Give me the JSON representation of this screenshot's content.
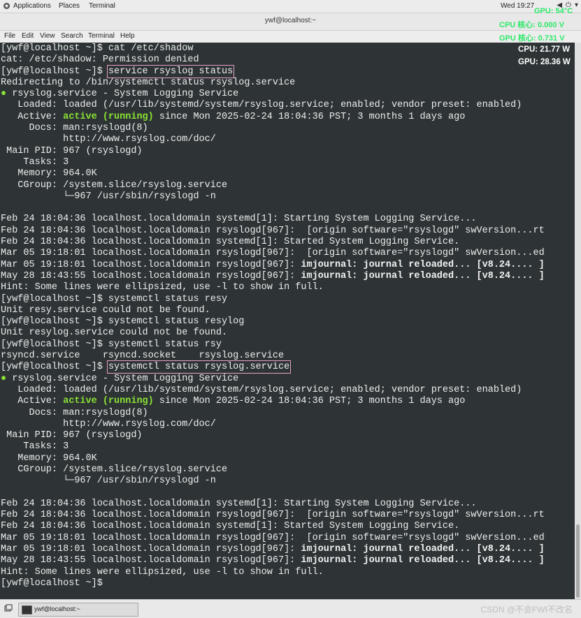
{
  "top_panel": {
    "applications": "Applications",
    "places": "Places",
    "terminal": "Terminal",
    "clock": "Wed 19:27"
  },
  "window": {
    "title": "ywf@localhost:~"
  },
  "menu": [
    "File",
    "Edit",
    "View",
    "Search",
    "Terminal",
    "Help"
  ],
  "overlay": {
    "gpu_temp": "GPU: 54°C",
    "cpu_core_v": "CPU 核心: 0.000 V",
    "gpu_core_v": "GPU 核心: 0.731 V",
    "cpu_w": "CPU: 21.77 W",
    "gpu_w": "GPU: 28.36 W"
  },
  "terminal": {
    "colors": {
      "background": "#2e3436",
      "green": "#8ae234",
      "highlight": "#e8a0c8"
    },
    "lines": [
      {
        "t": "[ywf@localhost ~]$ cat /etc/shadow"
      },
      {
        "t": "cat: /etc/shadow: Permission denied"
      },
      {
        "s": [
          {
            "t": "[ywf@localhost ~]$ "
          },
          {
            "t": "service rsyslog status",
            "c": "hl"
          }
        ]
      },
      {
        "t": "Redirecting to /bin/systemctl status rsyslog.service"
      },
      {
        "s": [
          {
            "t": "●",
            "c": "dot"
          },
          {
            "t": " rsyslog.service - System Logging Service"
          }
        ]
      },
      {
        "t": "   Loaded: loaded (/usr/lib/systemd/system/rsyslog.service; enabled; vendor preset: enabled)"
      },
      {
        "s": [
          {
            "t": "   Active: "
          },
          {
            "t": "active (running)",
            "c": "g"
          },
          {
            "t": " since Mon 2025-02-24 18:04:36 PST; 3 months 1 days ago"
          }
        ]
      },
      {
        "t": "     Docs: man:rsyslogd(8)"
      },
      {
        "t": "           http://www.rsyslog.com/doc/"
      },
      {
        "t": " Main PID: 967 (rsyslogd)"
      },
      {
        "t": "    Tasks: 3"
      },
      {
        "t": "   Memory: 964.0K"
      },
      {
        "t": "   CGroup: /system.slice/rsyslog.service"
      },
      {
        "t": "           └─967 /usr/sbin/rsyslogd -n"
      },
      {
        "t": ""
      },
      {
        "t": "Feb 24 18:04:36 localhost.localdomain systemd[1]: Starting System Logging Service..."
      },
      {
        "t": "Feb 24 18:04:36 localhost.localdomain rsyslogd[967]:  [origin software=\"rsyslogd\" swVersion...rt"
      },
      {
        "t": "Feb 24 18:04:36 localhost.localdomain systemd[1]: Started System Logging Service."
      },
      {
        "t": "Mar 05 19:18:01 localhost.localdomain rsyslogd[967]:  [origin software=\"rsyslogd\" swVersion...ed"
      },
      {
        "s": [
          {
            "t": "Mar 05 19:18:01 localhost.localdomain rsyslogd[967]: "
          },
          {
            "t": "imjournal: journal reloaded... [v8.24.... ]",
            "c": "b"
          }
        ]
      },
      {
        "s": [
          {
            "t": "May 28 18:43:55 localhost.localdomain rsyslogd[967]: "
          },
          {
            "t": "imjournal: journal reloaded... [v8.24.... ]",
            "c": "b"
          }
        ]
      },
      {
        "t": "Hint: Some lines were ellipsized, use -l to show in full."
      },
      {
        "t": "[ywf@localhost ~]$ systemctl status resy"
      },
      {
        "t": "Unit resy.service could not be found."
      },
      {
        "t": "[ywf@localhost ~]$ systemctl status resylog"
      },
      {
        "t": "Unit resylog.service could not be found."
      },
      {
        "t": "[ywf@localhost ~]$ systemctl status rsy"
      },
      {
        "t": "rsyncd.service    rsyncd.socket    rsyslog.service"
      },
      {
        "s": [
          {
            "t": "[ywf@localhost ~]$ "
          },
          {
            "t": "systemctl status rsyslog.service",
            "c": "hl"
          }
        ]
      },
      {
        "s": [
          {
            "t": "●",
            "c": "dot"
          },
          {
            "t": " rsyslog.service - System Logging Service"
          }
        ]
      },
      {
        "t": "   Loaded: loaded (/usr/lib/systemd/system/rsyslog.service; enabled; vendor preset: enabled)"
      },
      {
        "s": [
          {
            "t": "   Active: "
          },
          {
            "t": "active (running)",
            "c": "g"
          },
          {
            "t": " since Mon 2025-02-24 18:04:36 PST; 3 months 1 days ago"
          }
        ]
      },
      {
        "t": "     Docs: man:rsyslogd(8)"
      },
      {
        "t": "           http://www.rsyslog.com/doc/"
      },
      {
        "t": " Main PID: 967 (rsyslogd)"
      },
      {
        "t": "    Tasks: 3"
      },
      {
        "t": "   Memory: 964.0K"
      },
      {
        "t": "   CGroup: /system.slice/rsyslog.service"
      },
      {
        "t": "           └─967 /usr/sbin/rsyslogd -n"
      },
      {
        "t": ""
      },
      {
        "t": "Feb 24 18:04:36 localhost.localdomain systemd[1]: Starting System Logging Service..."
      },
      {
        "t": "Feb 24 18:04:36 localhost.localdomain rsyslogd[967]:  [origin software=\"rsyslogd\" swVersion...rt"
      },
      {
        "t": "Feb 24 18:04:36 localhost.localdomain systemd[1]: Started System Logging Service."
      },
      {
        "t": "Mar 05 19:18:01 localhost.localdomain rsyslogd[967]:  [origin software=\"rsyslogd\" swVersion...ed"
      },
      {
        "s": [
          {
            "t": "Mar 05 19:18:01 localhost.localdomain rsyslogd[967]: "
          },
          {
            "t": "imjournal: journal reloaded... [v8.24.... ]",
            "c": "b"
          }
        ]
      },
      {
        "s": [
          {
            "t": "May 28 18:43:55 localhost.localdomain rsyslogd[967]: "
          },
          {
            "t": "imjournal: journal reloaded... [v8.24.... ]",
            "c": "b"
          }
        ]
      },
      {
        "t": "Hint: Some lines were ellipsized, use -l to show in full."
      },
      {
        "t": "[ywf@localhost ~]$ "
      }
    ]
  },
  "taskbar": {
    "window_button": "ywf@localhost:~",
    "watermark": "CSDN @不会FWI不改名"
  }
}
